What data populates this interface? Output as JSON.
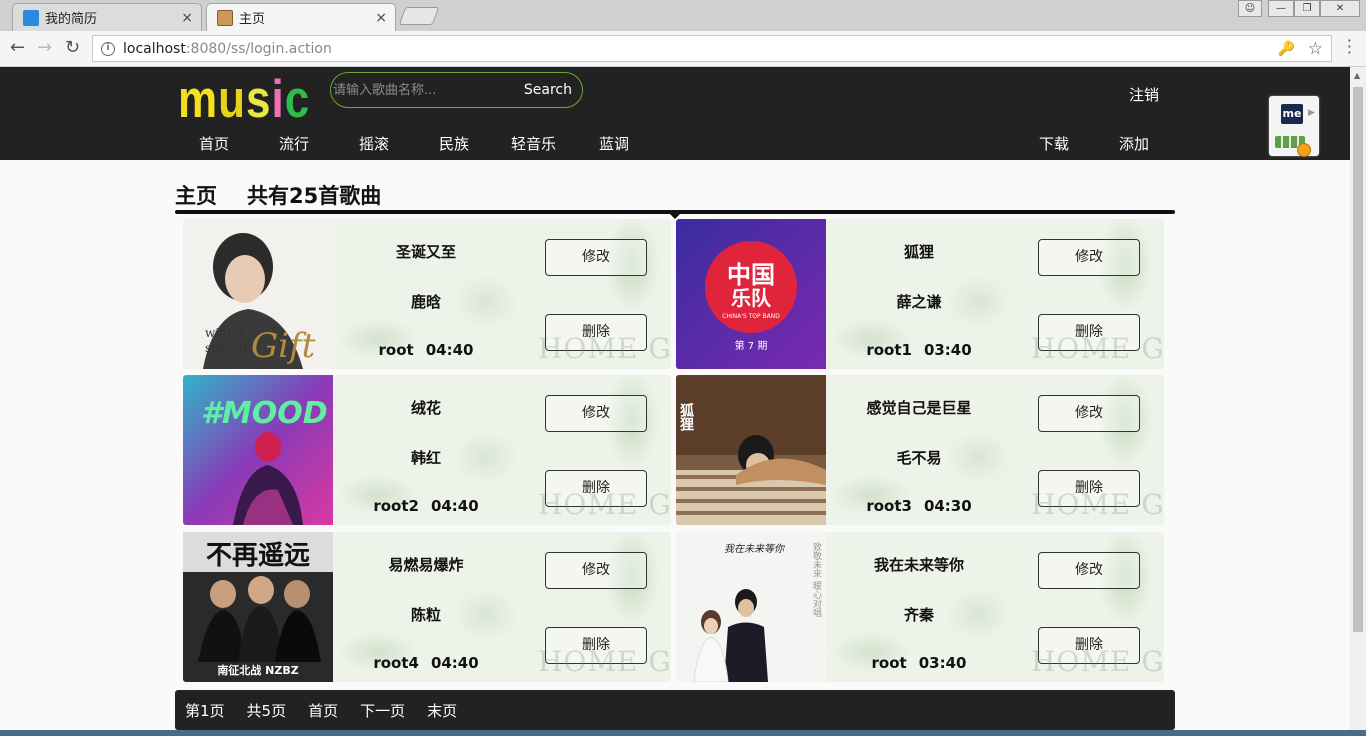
{
  "browser": {
    "tabs": [
      {
        "label": "我的简历",
        "close": "×"
      },
      {
        "label": "主页",
        "close": "×"
      }
    ],
    "url_host": "localhost",
    "url_path": ":8080/ss/login.action"
  },
  "header": {
    "logo": {
      "m": "m",
      "u": "u",
      "s": "s",
      "i": "i",
      "c": "c"
    },
    "search_placeholder": "请输入歌曲名称...",
    "search_button": "Search",
    "logout": "注销",
    "nav": [
      "首页",
      "流行",
      "摇滚",
      "民族",
      "轻音乐",
      "蓝调"
    ],
    "nav_right": [
      "下载",
      "添加"
    ],
    "extension_label": "me"
  },
  "main": {
    "section_title": "主页",
    "song_count_text": "共有25首歌曲",
    "songs": [
      {
        "title": "圣诞又至",
        "artist": "鹿晗",
        "user": "root",
        "duration": "04:40"
      },
      {
        "title": "狐狸",
        "artist": "薛之谦",
        "user": "root1",
        "duration": "03:40"
      },
      {
        "title": "绒花",
        "artist": "韩红",
        "user": "root2",
        "duration": "04:40"
      },
      {
        "title": "感觉自己是巨星",
        "artist": "毛不易",
        "user": "root3",
        "duration": "04:30"
      },
      {
        "title": "易燃易爆炸",
        "artist": "陈粒",
        "user": "root4",
        "duration": "04:40"
      },
      {
        "title": "我在未来等你",
        "artist": "齐秦",
        "user": "root",
        "duration": "03:40"
      }
    ],
    "edit_label": "修改",
    "delete_label": "删除",
    "watermark": "HOME GARDEN",
    "cover_texts": {
      "c1a": "winter",
      "c1b": "special",
      "c1c": "Gift",
      "c2a": "中国",
      "c2b": "乐队",
      "c2c": "CHINA'S TOP BAND",
      "c2d": "第 7 期",
      "c3a": "#MOOD",
      "c4a": "狐狸",
      "c5a": "不再遥远",
      "c5b": "南征北战 NZBZ",
      "c6a": "我在未来等你",
      "c6b": "致敬未来 暖心对唱"
    }
  },
  "pager": {
    "current": "第1页",
    "total": "共5页",
    "first": "首页",
    "next": "下一页",
    "last": "末页"
  }
}
